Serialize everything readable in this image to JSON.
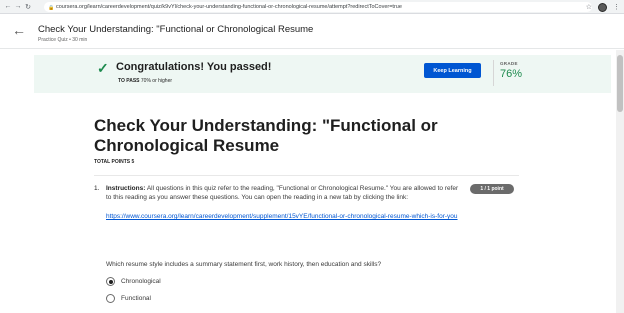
{
  "browser": {
    "url": "coursera.org/learn/careerdevelopment/quiz/k9vYl/check-your-understanding-functional-or-chronological-resume/attempt?redirectToCover=true"
  },
  "header": {
    "title": "Check Your Understanding: \"Functional or Chronological Resume",
    "subtitle": "Practice Quiz • 30 min"
  },
  "banner": {
    "message": "Congratulations! You passed!",
    "to_pass_label": "TO PASS",
    "to_pass_value": "70% or higher",
    "keep_learning_label": "Keep Learning",
    "grade_label": "GRADE",
    "grade_value": "76%",
    "accent_color": "#1d8a4e"
  },
  "quiz": {
    "title": "Check Your Understanding: \"Functional or Chronological Resume",
    "total_points": "TOTAL POINTS 5",
    "question": {
      "number": "1.",
      "instructions_label": "Instructions:",
      "instructions_text": "All questions in this quiz refer to the reading, \"Functional or Chronological Resume.\" You are allowed to refer to this reading as you answer these questions. You can open the reading in a new tab by clicking the link:",
      "points": "1 / 1 point",
      "link": "https://www.coursera.org/learn/careerdevelopment/supplement/15vYE/functional-or-chronological-resume-which-is-for-you",
      "sub_question": "Which resume style includes a summary statement first, work history, then education and skills?",
      "options": [
        {
          "label": "Chronological",
          "selected": true
        },
        {
          "label": "Functional",
          "selected": false
        }
      ]
    }
  },
  "icons": {
    "back": "arrow-left-icon",
    "forward": "arrow-right-icon",
    "reload": "reload-icon",
    "lock": "lock-icon",
    "star": "star-icon",
    "check": "checkmark-icon"
  }
}
